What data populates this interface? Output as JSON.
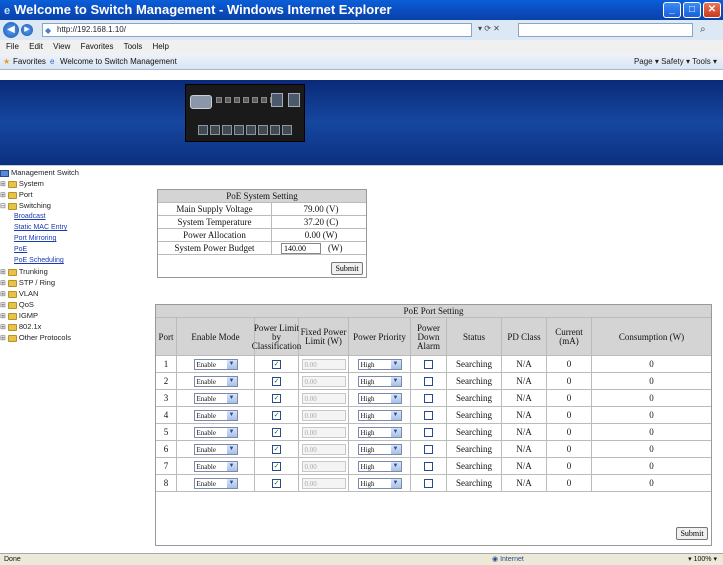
{
  "window": {
    "title": "Welcome to Switch Management - Windows Internet Explorer",
    "url": "http://192.168.1.10/",
    "menu": [
      "File",
      "Edit",
      "View",
      "Favorites",
      "Tools",
      "Help"
    ],
    "favorites_label": "Favorites",
    "tab_label": "Welcome to Switch Management",
    "tools_right": "Page ▾  Safety ▾  Tools ▾",
    "status_left": "Done",
    "status_zone": "Internet",
    "status_zoom": "100%"
  },
  "sidebar": {
    "root": "Management Switch",
    "items": [
      "System",
      "Port",
      "Switching",
      "Trunking",
      "STP / Ring",
      "VLAN",
      "QoS",
      "IGMP",
      "802.1x",
      "Other Protocols"
    ],
    "switching_links": [
      "Broadcast",
      "Static MAC Entry",
      "Port Mirroring",
      "PoE",
      "PoE Scheduling"
    ]
  },
  "poe_system": {
    "title": "PoE System Setting",
    "rows": [
      {
        "label": "Main Supply Voltage",
        "value": "79.00 (V)"
      },
      {
        "label": "System Temperature",
        "value": "37.20 (C)"
      },
      {
        "label": "Power Allocation",
        "value": "0.00 (W)"
      },
      {
        "label": "System Power Budget",
        "value": "140.00",
        "unit": "(W)"
      }
    ],
    "submit_label": "Submit"
  },
  "poe_ports": {
    "title": "PoE Port Setting",
    "headers": [
      "Port",
      "Enable Mode",
      "Power Limit by Classification",
      "Fixed Power Limit (W)",
      "Power Priority",
      "Power Down Alarm",
      "Status",
      "PD Class",
      "Current (mA)",
      "Consumption (W)"
    ],
    "rows": [
      {
        "port": "1",
        "mode": "Enable",
        "fixed": "0.00",
        "priority": "High",
        "status": "Searching",
        "pd_class": "N/A",
        "current": "0",
        "consumption": "0"
      },
      {
        "port": "2",
        "mode": "Enable",
        "fixed": "0.00",
        "priority": "High",
        "status": "Searching",
        "pd_class": "N/A",
        "current": "0",
        "consumption": "0"
      },
      {
        "port": "3",
        "mode": "Enable",
        "fixed": "0.00",
        "priority": "High",
        "status": "Searching",
        "pd_class": "N/A",
        "current": "0",
        "consumption": "0"
      },
      {
        "port": "4",
        "mode": "Enable",
        "fixed": "0.00",
        "priority": "High",
        "status": "Searching",
        "pd_class": "N/A",
        "current": "0",
        "consumption": "0"
      },
      {
        "port": "5",
        "mode": "Enable",
        "fixed": "0.00",
        "priority": "High",
        "status": "Searching",
        "pd_class": "N/A",
        "current": "0",
        "consumption": "0"
      },
      {
        "port": "6",
        "mode": "Enable",
        "fixed": "0.00",
        "priority": "High",
        "status": "Searching",
        "pd_class": "N/A",
        "current": "0",
        "consumption": "0"
      },
      {
        "port": "7",
        "mode": "Enable",
        "fixed": "0.00",
        "priority": "High",
        "status": "Searching",
        "pd_class": "N/A",
        "current": "0",
        "consumption": "0"
      },
      {
        "port": "8",
        "mode": "Enable",
        "fixed": "0.00",
        "priority": "High",
        "status": "Searching",
        "pd_class": "N/A",
        "current": "0",
        "consumption": "0"
      }
    ],
    "submit_label": "Submit"
  },
  "colors": {
    "title_bar": "#0b4fc3",
    "banner": "#16479f",
    "table_header": "#d4d4d4",
    "link": "#1a3ab0"
  }
}
